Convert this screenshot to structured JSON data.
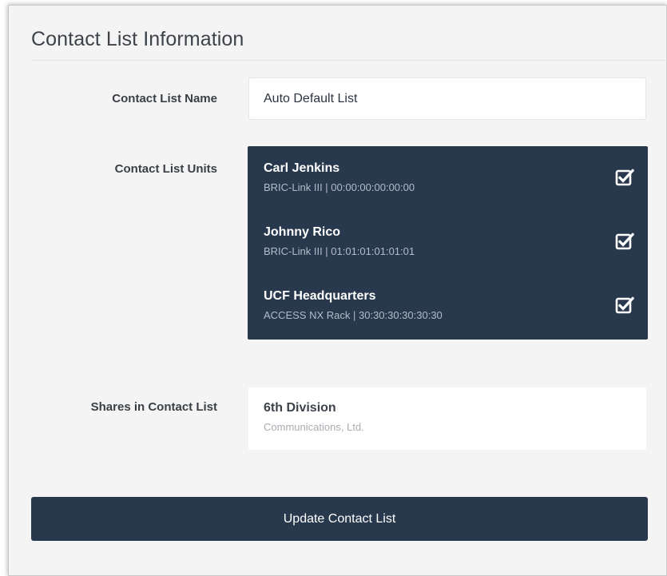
{
  "section": {
    "title": "Contact List Information"
  },
  "form": {
    "name_label": "Contact List Name",
    "name_value": "Auto Default List",
    "units_label": "Contact List Units",
    "shares_label": "Shares in Contact List"
  },
  "units": [
    {
      "name": "Carl Jenkins",
      "detail": "BRIC-Link III | 00:00:00:00:00:00",
      "checked": true
    },
    {
      "name": "Johnny Rico",
      "detail": "BRIC-Link III | 01:01:01:01:01:01",
      "checked": true
    },
    {
      "name": "UCF Headquarters",
      "detail": "ACCESS NX Rack | 30:30:30:30:30:30",
      "checked": true
    }
  ],
  "shares": [
    {
      "name": "6th Division",
      "detail": "Communications, Ltd."
    }
  ],
  "actions": {
    "update_label": "Update Contact List"
  },
  "colors": {
    "panel_dark": "#29394d",
    "panel_bg": "#f4f4f4",
    "check": "#ffffff"
  },
  "icons": {
    "unit_checkbox": "checked-square-icon"
  }
}
